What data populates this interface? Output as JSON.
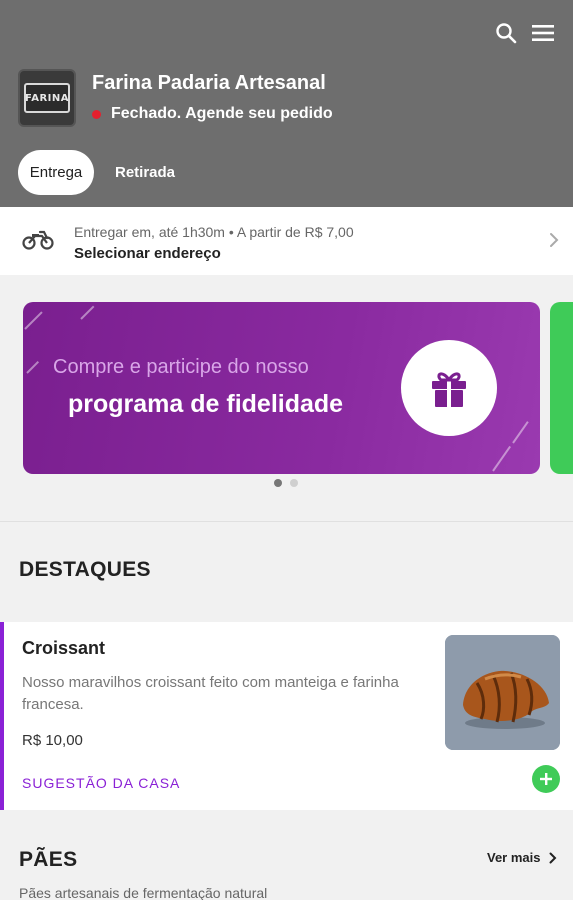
{
  "header": {
    "store_name": "Farina Padaria Artesanal",
    "logo_text": "FARINA",
    "status": "Fechado. Agende seu pedido",
    "status_color": "#e5202e",
    "search_icon": "search-icon",
    "menu_icon": "menu-icon",
    "tabs": [
      {
        "label": "Entrega",
        "active": true
      },
      {
        "label": "Retirada",
        "active": false
      }
    ]
  },
  "delivery": {
    "icon": "motorcycle-icon",
    "info": "Entregar em, até 1h30m • A partir de R$ 7,00",
    "action": "Selecionar endereço"
  },
  "banner": {
    "line1": "Compre e participe do nosso",
    "line2": "programa de fidelidade",
    "icon": "gift-icon",
    "color": "#7a1f8f",
    "next_banner_color": "#3fcb58",
    "slide_count": 2,
    "active_slide": 1
  },
  "highlights": {
    "title": "DESTAQUES",
    "product": {
      "name": "Croissant",
      "description": "Nosso maravilhos croissant feito com manteiga e farinha francesa.",
      "price": "R$ 10,00",
      "tag": "SUGESTÃO DA CASA",
      "accent": "#8a21d6",
      "add_icon": "plus-icon"
    }
  },
  "paes": {
    "title": "PÃES",
    "see_more": "Ver mais",
    "subtitle": "Pães artesanais de fermentação natural"
  }
}
